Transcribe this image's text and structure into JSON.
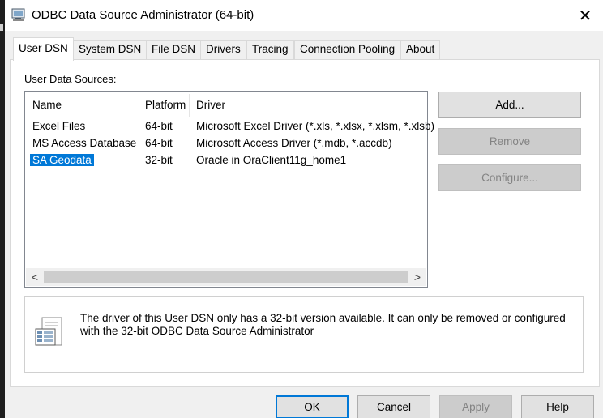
{
  "window": {
    "title": "ODBC Data Source Administrator (64-bit)",
    "close_glyph": "✕"
  },
  "tabs": [
    {
      "label": "User DSN"
    },
    {
      "label": "System DSN"
    },
    {
      "label": "File DSN"
    },
    {
      "label": "Drivers"
    },
    {
      "label": "Tracing"
    },
    {
      "label": "Connection Pooling"
    },
    {
      "label": "About"
    }
  ],
  "user_dsn": {
    "sources_label": "User Data Sources:",
    "columns": [
      "Name",
      "Platform",
      "Driver"
    ],
    "rows": [
      {
        "name": "Excel Files",
        "platform": "64-bit",
        "driver": "Microsoft Excel Driver (*.xls, *.xlsx, *.xlsm, *.xlsb)"
      },
      {
        "name": "MS Access Database",
        "platform": "64-bit",
        "driver": "Microsoft Access Driver (*.mdb, *.accdb)"
      },
      {
        "name": "SA Geodata",
        "platform": "32-bit",
        "driver": "Oracle in OraClient11g_home1"
      }
    ],
    "selected_row": "SA Geodata",
    "scroll_left_glyph": "<",
    "scroll_right_glyph": ">",
    "buttons": {
      "add": "Add...",
      "remove": "Remove",
      "configure": "Configure..."
    },
    "info_text": "The driver of this User DSN only has a 32-bit version available. It can only be removed or configured with the 32-bit ODBC Data Source Administrator"
  },
  "footer": {
    "ok": "OK",
    "cancel": "Cancel",
    "apply": "Apply",
    "help": "Help"
  },
  "colors": {
    "selection": "#0078d7",
    "dialog_bg": "#f0f0f0",
    "default_button_border": "#0078d7"
  }
}
